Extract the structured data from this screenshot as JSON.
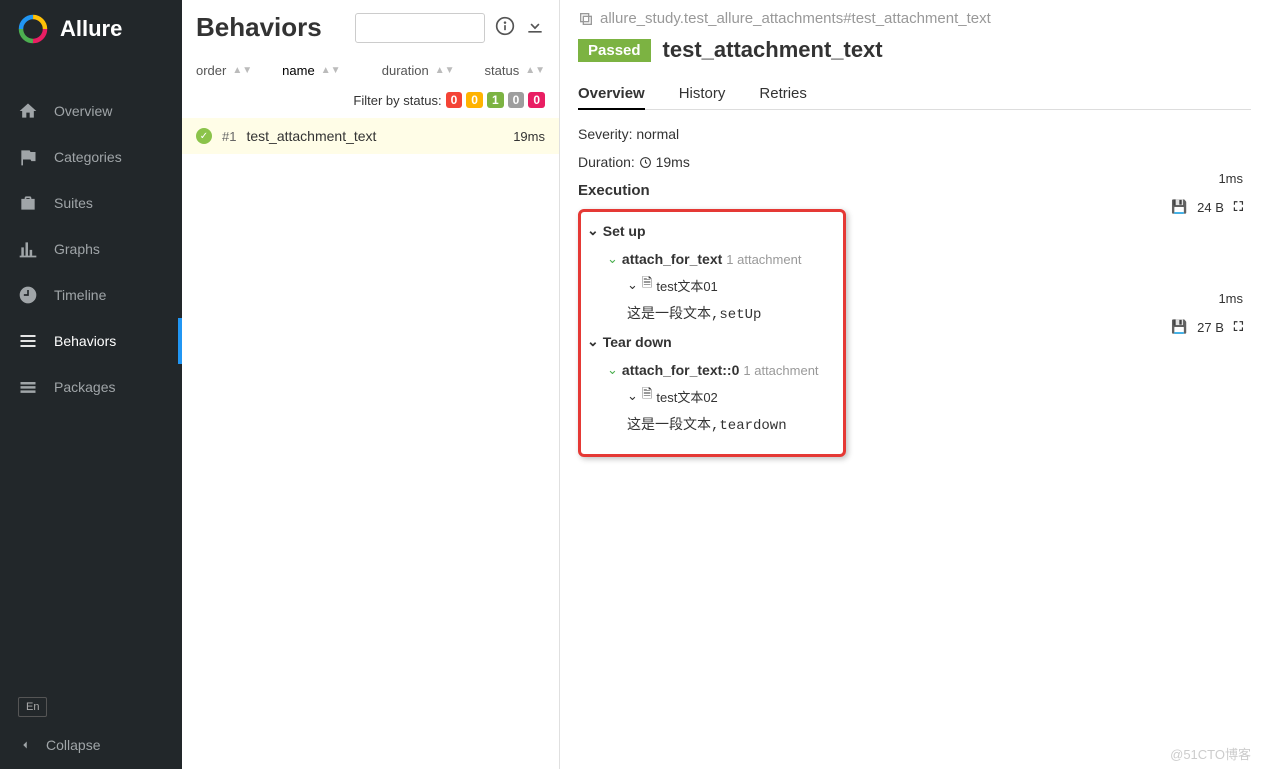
{
  "sidebar": {
    "brand": "Allure",
    "items": [
      {
        "label": "Overview"
      },
      {
        "label": "Categories"
      },
      {
        "label": "Suites"
      },
      {
        "label": "Graphs"
      },
      {
        "label": "Timeline"
      },
      {
        "label": "Behaviors"
      },
      {
        "label": "Packages"
      }
    ],
    "lang": "En",
    "collapse": "Collapse"
  },
  "middle": {
    "title": "Behaviors",
    "sort_cols": [
      "order",
      "name",
      "duration",
      "status"
    ],
    "filter_label": "Filter by status:",
    "filter_badges": [
      {
        "val": "0",
        "color": "#f44336"
      },
      {
        "val": "0",
        "color": "#ffb300"
      },
      {
        "val": "1",
        "color": "#7cb342"
      },
      {
        "val": "0",
        "color": "#9e9e9e"
      },
      {
        "val": "0",
        "color": "#e91e63"
      }
    ],
    "tests": [
      {
        "id": "#1",
        "name": "test_attachment_text",
        "duration": "19ms"
      }
    ]
  },
  "right": {
    "breadcrumb": "allure_study.test_allure_attachments#test_attachment_text",
    "status": "Passed",
    "title": "test_attachment_text",
    "tabs": [
      "Overview",
      "History",
      "Retries"
    ],
    "severity_label": "Severity:",
    "severity_value": "normal",
    "duration_label": "Duration:",
    "duration_value": "19ms",
    "execution_label": "Execution",
    "setup": {
      "label": "Set up",
      "fixture": "attach_for_text",
      "att_count": "1 attachment",
      "att_name": "test文本01",
      "att_size": "24 B",
      "content": "这是一段文本,setUp",
      "dur": "1ms"
    },
    "teardown": {
      "label": "Tear down",
      "fixture": "attach_for_text::0",
      "att_count": "1 attachment",
      "att_name": "test文本02",
      "att_size": "27 B",
      "content": "这是一段文本,teardown",
      "dur": "1ms"
    }
  },
  "watermark": "@51CTO博客"
}
